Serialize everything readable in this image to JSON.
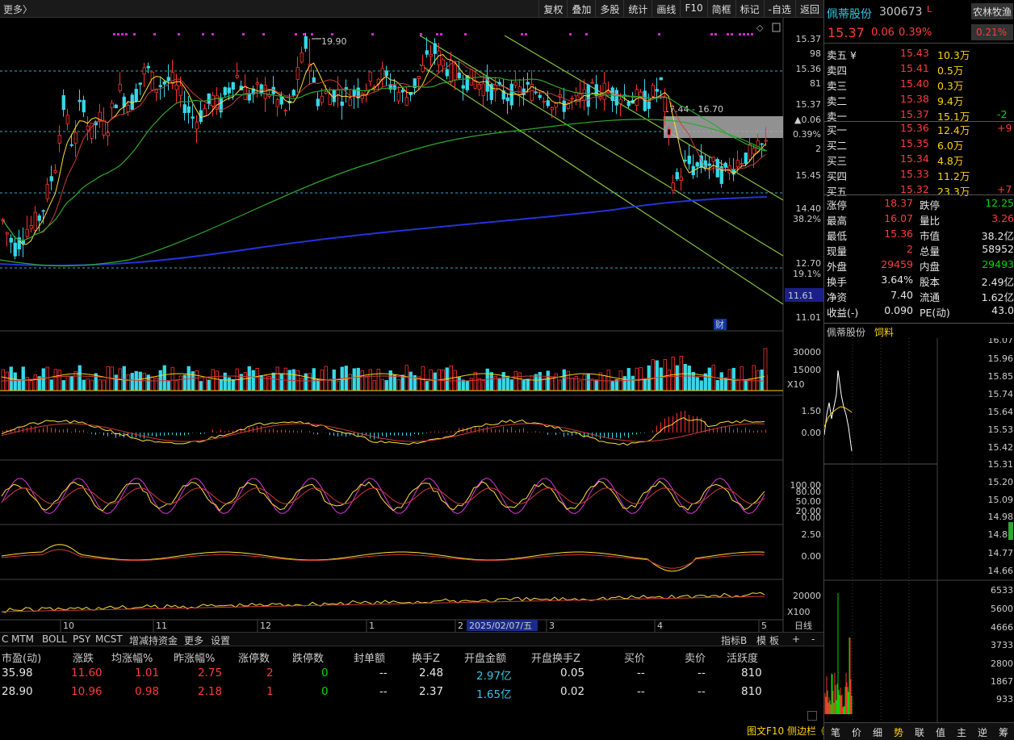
{
  "toolbar": {
    "more": "更多〉",
    "buttons": [
      "复权",
      "叠加",
      "多股",
      "统计",
      "画线",
      "F10",
      "简框",
      "标记",
      "-自选",
      "返回"
    ]
  },
  "stock": {
    "name": "佩蒂股份",
    "code": "300673",
    "flag": "L",
    "sector": "农林牧渔",
    "price": "15.37",
    "change": "0.06",
    "change_pct": "0.39%",
    "sector_pct": "0.21%"
  },
  "order_book": {
    "asks": [
      {
        "label": "卖五 ¥",
        "price": "15.43",
        "vol": "10.3万",
        "chg": ""
      },
      {
        "label": "卖四",
        "price": "15.41",
        "vol": "0.5万",
        "chg": ""
      },
      {
        "label": "卖三",
        "price": "15.40",
        "vol": "0.3万",
        "chg": ""
      },
      {
        "label": "卖二",
        "price": "15.38",
        "vol": "9.4万",
        "chg": ""
      },
      {
        "label": "卖一",
        "price": "15.37",
        "vol": "15.1万",
        "chg": "-2"
      }
    ],
    "bids": [
      {
        "label": "买一",
        "price": "15.36",
        "vol": "12.4万",
        "chg": "+9"
      },
      {
        "label": "买二",
        "price": "15.35",
        "vol": "6.0万",
        "chg": ""
      },
      {
        "label": "买三",
        "price": "15.34",
        "vol": "4.8万",
        "chg": ""
      },
      {
        "label": "买四",
        "price": "15.33",
        "vol": "11.2万",
        "chg": ""
      },
      {
        "label": "买五",
        "price": "15.32",
        "vol": "23.3万",
        "chg": "+7"
      }
    ]
  },
  "stats": [
    [
      {
        "k": "涨停",
        "v": "18.37",
        "c": "red"
      },
      {
        "k": "跌停",
        "v": "12.25",
        "c": "green"
      }
    ],
    [
      {
        "k": "最高",
        "v": "16.07",
        "c": "red"
      },
      {
        "k": "量比",
        "v": "3.26",
        "c": "red"
      }
    ],
    [
      {
        "k": "最低",
        "v": "15.36",
        "c": "red"
      },
      {
        "k": "市值",
        "v": "38.2亿",
        "c": "white"
      }
    ],
    [
      {
        "k": "现量",
        "v": "2",
        "c": "red"
      },
      {
        "k": "总量",
        "v": "58952",
        "c": "white"
      }
    ],
    [
      {
        "k": "外盘",
        "v": "29459",
        "c": "red"
      },
      {
        "k": "内盘",
        "v": "29493",
        "c": "green"
      }
    ],
    [
      {
        "k": "换手",
        "v": "3.64%",
        "c": "white"
      },
      {
        "k": "股本",
        "v": "2.49亿",
        "c": "white"
      }
    ],
    [
      {
        "k": "净资",
        "v": "7.40",
        "c": "white"
      },
      {
        "k": "流通",
        "v": "1.62亿",
        "c": "white"
      }
    ],
    [
      {
        "k": "收益(-)",
        "v": "0.090",
        "c": "white"
      },
      {
        "k": "PE(动)",
        "v": "43.0",
        "c": "white"
      }
    ]
  ],
  "intraday": {
    "title": "佩蒂股份",
    "tag": "饲料",
    "price_labels": [
      "16.07",
      "15.96",
      "15.85",
      "15.74",
      "15.64",
      "15.53",
      "15.42",
      "15.31",
      "15.20",
      "15.09",
      "14.98",
      "14.88",
      "14.77",
      "14.66"
    ],
    "vol_labels": [
      "6533",
      "5600",
      "4666",
      "3733",
      "2800",
      "1867",
      "933"
    ],
    "footer_tabs": [
      "笔",
      "价",
      "细",
      "势",
      "联",
      "值",
      "主",
      "逆",
      "筹"
    ]
  },
  "main_chart": {
    "y_labels": [
      "15.37",
      "98",
      "15.36",
      "81",
      "15.37",
      "▲0.06",
      "0.39%",
      "2",
      "15.45",
      "14.40",
      "38.2%",
      "12.70",
      "19.1%",
      "11.01"
    ],
    "current_box": "11.61",
    "high_label": "19.90",
    "range_label": "17.44 - 16.70",
    "cai_label": "财",
    "x_labels": [
      "10",
      "11",
      "12",
      "1",
      "2",
      "3",
      "4",
      "5"
    ],
    "date_highlight": "2025/02/07/五",
    "vol_labels": [
      "30000",
      "15000"
    ],
    "vol_unit": "X10",
    "macd_labels": [
      "1.50",
      "0.00"
    ],
    "kdj_labels": [
      "100.00",
      "80.00",
      "50.00",
      "20.00",
      "0.00"
    ],
    "ind4_labels": [
      "2.50",
      "0.00"
    ],
    "ind5_labels": [
      "20000"
    ],
    "ind5_unit": "X100",
    "period": "日线"
  },
  "bottom_tabs": [
    "C",
    "MTM",
    "BOLL",
    "PSY",
    "MCST",
    "增减持资金",
    "更多",
    "设置"
  ],
  "bottom_right_tabs": [
    "指标B",
    "模",
    "板",
    "+",
    "-"
  ],
  "table": {
    "headers": [
      "市盈(动)",
      "涨跌",
      "均涨幅%",
      "昨涨幅%",
      "涨停数",
      "跌停数",
      "封单额",
      "换手Z",
      "开盘金额",
      "开盘换手Z",
      "买价",
      "卖价",
      "活跃度"
    ],
    "rows": [
      [
        "35.98",
        "11.60",
        "1.01",
        "2.75",
        "2",
        "0",
        "--",
        "2.48",
        "2.97亿",
        "0.05",
        "--",
        "--",
        "810"
      ],
      [
        "28.90",
        "10.96",
        "0.98",
        "2.18",
        "1",
        "0",
        "--",
        "2.37",
        "1.65亿",
        "0.02",
        "--",
        "--",
        "810"
      ]
    ]
  },
  "footer_left": "图文F10 侧边栏《"
}
